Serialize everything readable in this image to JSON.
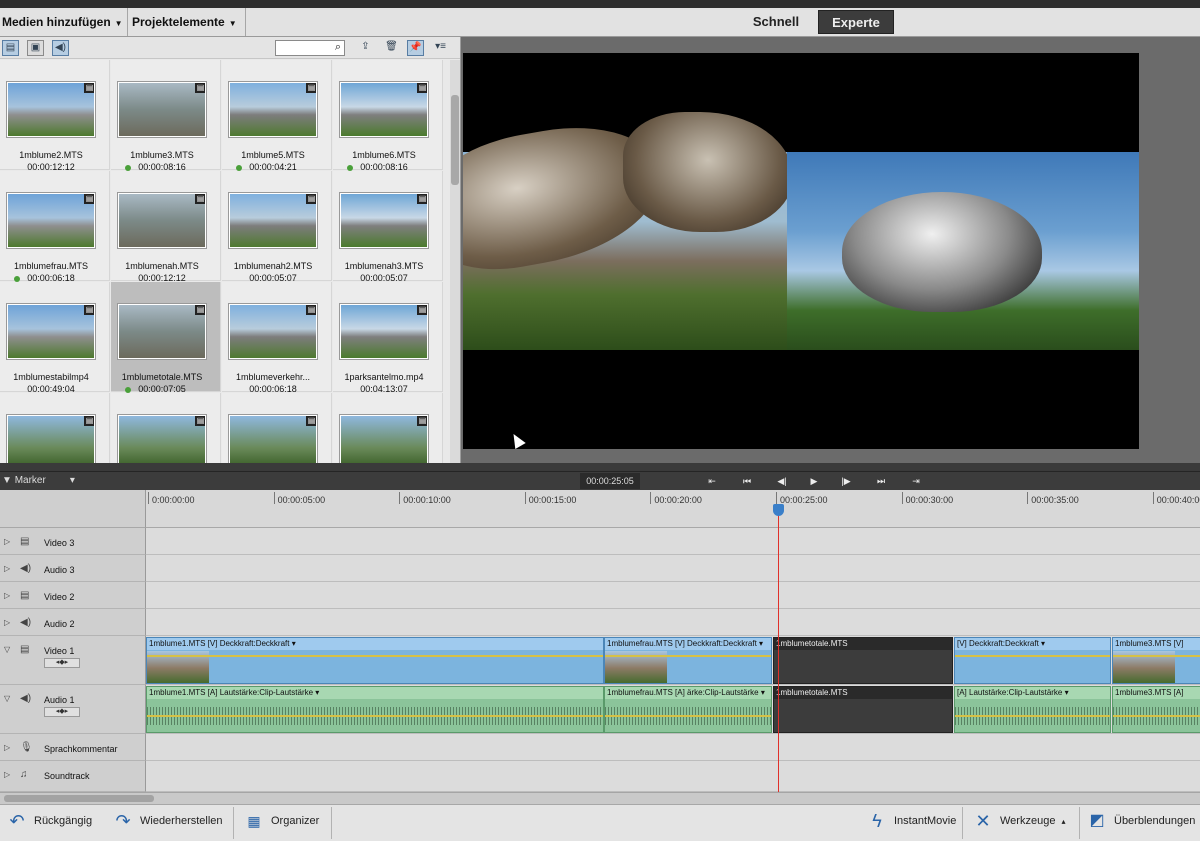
{
  "menubar": {
    "add_media": "Medien hinzufügen",
    "project_assets": "Projektelemente",
    "mode_quick": "Schnell",
    "mode_expert": "Experte"
  },
  "assets": [
    {
      "name": "1mblume2.MTS",
      "duration": "00:00:12:12",
      "used": false
    },
    {
      "name": "1mblume3.MTS",
      "duration": "00:00:08:16",
      "used": true
    },
    {
      "name": "1mblume5.MTS",
      "duration": "00:00:04:21",
      "used": true
    },
    {
      "name": "1mblume6.MTS",
      "duration": "00:00:08:16",
      "used": true
    },
    {
      "name": "1mblumefrau.MTS",
      "duration": "00:00:06:18",
      "used": true
    },
    {
      "name": "1mblumenah.MTS",
      "duration": "00:00:12:12",
      "used": false
    },
    {
      "name": "1mblumenah2.MTS",
      "duration": "00:00:05:07",
      "used": false
    },
    {
      "name": "1mblumenah3.MTS",
      "duration": "00:00:05:07",
      "used": false
    },
    {
      "name": "1mblumestabilmp4",
      "duration": "00:00:49:04",
      "used": false
    },
    {
      "name": "1mblumetotale.MTS",
      "duration": "00:00:07:05",
      "used": true,
      "selected": true
    },
    {
      "name": "1mblumeverkehr...",
      "duration": "00:00:06:18",
      "used": false
    },
    {
      "name": "1parksantelmo.mp4",
      "duration": "00:04:13:07",
      "used": false
    }
  ],
  "transport": {
    "marker": "Marker",
    "timecode": "00:00:25:05"
  },
  "ruler": [
    "0:00:00:00",
    "00:00:05:00",
    "00:00:10:00",
    "00:00:15:00",
    "00:00:20:00",
    "00:00:25:00",
    "00:00:30:00",
    "00:00:35:00",
    "00:00:40:00"
  ],
  "tracks": {
    "video3": "Video 3",
    "audio3": "Audio 3",
    "video2": "Video 2",
    "audio2": "Audio 2",
    "video1": "Video 1",
    "audio1": "Audio 1",
    "narration": "Sprachkommentar",
    "soundtrack": "Soundtrack"
  },
  "clips": {
    "v1_a": "1mblume1.MTS [V]  Deckkraft:Deckkraft ▾",
    "v1_b": "1mblumefrau.MTS [V]  Deckkraft:Deckkraft ▾",
    "v1_c": "1mblumetotale.MTS",
    "v1_d": "[V]  Deckkraft:Deckkraft ▾",
    "v1_e": "1mblume3.MTS [V]",
    "a1_a": "1mblume1.MTS [A]  Lautstärke:Clip-Lautstärke ▾",
    "a1_b": "1mblumefrau.MTS [A]  ärke:Clip-Lautstärke ▾",
    "a1_c": "1mblumetotale.MTS",
    "a1_d": "[A]  Lautstärke:Clip-Lautstärke ▾",
    "a1_e": "1mblume3.MTS [A]"
  },
  "bottombar": {
    "undo": "Rückgängig",
    "redo": "Wiederherstellen",
    "organizer": "Organizer",
    "instant_movie": "InstantMovie",
    "tools": "Werkzeuge",
    "transitions": "Überblendungen"
  },
  "colors": {
    "accent": "#3a7fc9",
    "video_clip": "#7cb4de",
    "audio_clip": "#8bc49a",
    "playhead": "#e0302a"
  }
}
